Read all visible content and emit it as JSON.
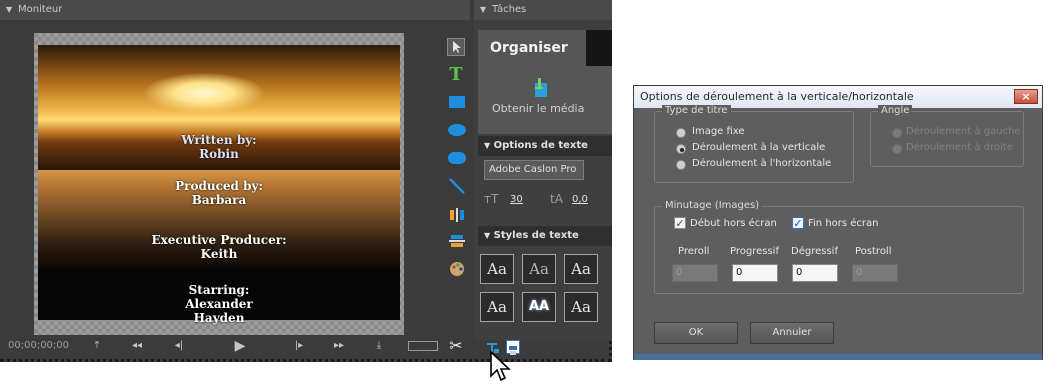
{
  "monitor": {
    "header_label": "Moniteur",
    "credits": {
      "written_by": "Written by:",
      "written_name": "Robin",
      "produced_by": "Produced by:",
      "produced_name": "Barbara",
      "executive": "Executive Producer:",
      "executive_name": "Keith",
      "starring": "Starring:",
      "starring_name_1": "Alexander",
      "starring_name_2": "Hayden"
    },
    "timecode": "00;00;00;00"
  },
  "tasks": {
    "header_label": "Tâches",
    "tab_organise": "Organiser",
    "get_media_label": "Obtenir le média",
    "text_options_header": "Options de texte",
    "font_name": "Adobe Caslon Pro",
    "font_size": "30",
    "leading": "0,0",
    "text_styles_header": "Styles de texte",
    "styles": [
      "Aa",
      "Aa",
      "Aa",
      "Aa",
      "AA",
      "Aa"
    ]
  },
  "dialog": {
    "title": "Options de déroulement à la verticale/horizontale",
    "close_label": "×",
    "title_type": {
      "label": "Type de titre",
      "options": [
        "Image fixe",
        "Déroulement à la verticale",
        "Déroulement à l'horizontale"
      ],
      "selected": 1
    },
    "angle": {
      "label": "Angle",
      "options": [
        "Déroulement à gauche",
        "Déroulement à droite"
      ]
    },
    "timing": {
      "label": "Minutage (Images)",
      "start_offscreen": "Début hors écran",
      "end_offscreen": "Fin hors écran",
      "preroll_label": "Preroll",
      "preroll_value": "0",
      "ease_in_label": "Progressif",
      "ease_in_value": "0",
      "ease_out_label": "Dégressif",
      "ease_out_value": "0",
      "postroll_label": "Postroll",
      "postroll_value": "0"
    },
    "ok_label": "OK",
    "cancel_label": "Annuler"
  }
}
